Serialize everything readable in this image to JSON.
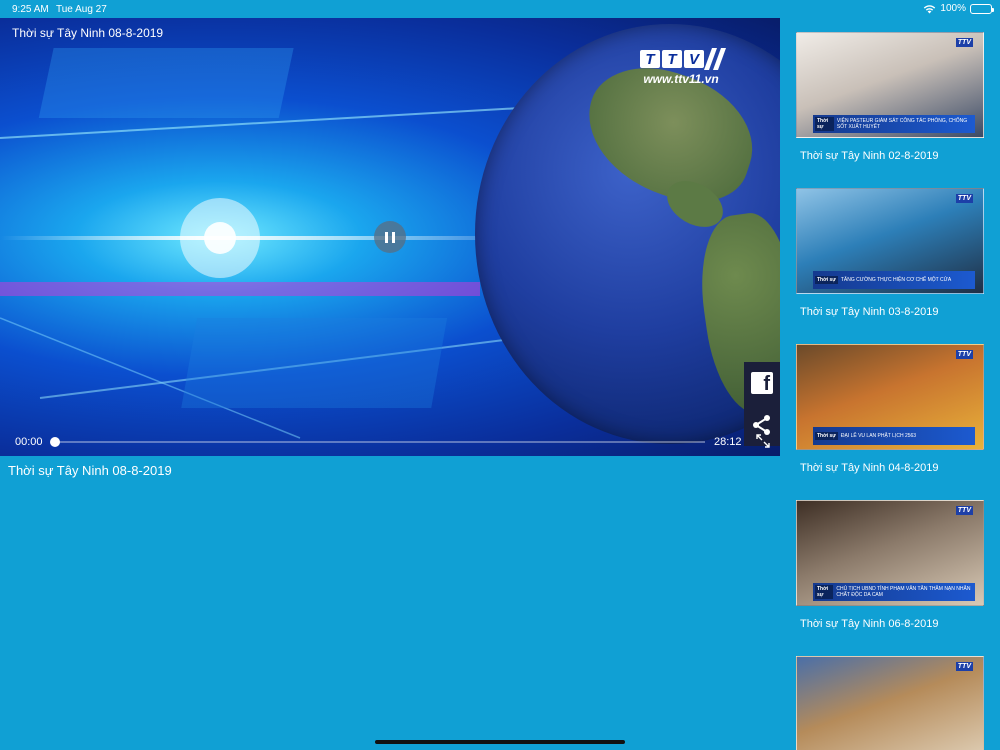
{
  "status_bar": {
    "time": "9:25 AM",
    "date": "Tue Aug 27",
    "battery": "100%"
  },
  "player": {
    "title": "Thời sự Tây Ninh 08-8-2019",
    "logo_text": "TTV",
    "logo_url": "www.ttv11.vn",
    "current_time": "00:00",
    "total_time": "28:12",
    "progress_fraction": 0.0,
    "icons": {
      "pause": "pause-icon",
      "facebook": "facebook-icon",
      "share": "share-icon",
      "fullscreen": "fullscreen-icon"
    }
  },
  "caption": "Thời sự Tây Ninh 08-8-2019",
  "sidebar": {
    "items": [
      {
        "title": "Thời sự Tây Ninh 02-8-2019",
        "banner_tag": "Thời sự",
        "banner_text": "VIỆN PASTEUR GIÁM SÁT CÔNG TÁC PHÒNG, CHỐNG SỐT XUẤT HUYẾT",
        "colors": [
          "#c9c0b8",
          "#3b4a66",
          "#f0ece7"
        ]
      },
      {
        "title": "Thời sự Tây Ninh 03-8-2019",
        "banner_tag": "Thời sự",
        "banner_text": "TĂNG CƯỜNG THỰC HIỆN CƠ CHẾ MỘT CỬA",
        "colors": [
          "#2d7fb8",
          "#1f2f45",
          "#8fc3e6"
        ]
      },
      {
        "title": "Thời sự Tây Ninh 04-8-2019",
        "banner_tag": "Thời sự",
        "banner_text": "ĐẠI LỄ VU LAN PHẬT LỊCH 2563",
        "colors": [
          "#c8742f",
          "#e9b23a",
          "#6b4a2a"
        ]
      },
      {
        "title": "Thời sự Tây Ninh 06-8-2019",
        "banner_tag": "Thời sự",
        "banner_text": "CHỦ TỊCH UBND TỈNH PHẠM VĂN TÂN THĂM NẠN NHÂN CHẤT ĐỘC DA CAM",
        "colors": [
          "#8b7a6a",
          "#d8c9b5",
          "#3e2f25"
        ]
      },
      {
        "title": "",
        "banner_tag": "",
        "banner_text": "",
        "colors": [
          "#b58b5a",
          "#e0d0b8",
          "#4a6fa8"
        ]
      }
    ]
  }
}
